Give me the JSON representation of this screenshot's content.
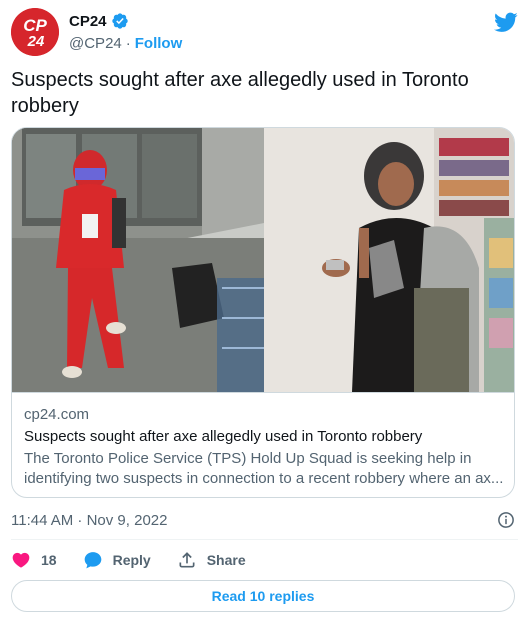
{
  "account": {
    "avatar_text_top": "CP",
    "avatar_text_bottom": "24",
    "display_name": "CP24",
    "handle": "@CP24",
    "separator": "·",
    "follow_label": "Follow",
    "verified": true
  },
  "tweet": {
    "text": "Suspects sought after axe allegedly used in Toronto robbery"
  },
  "card": {
    "domain": "cp24.com",
    "title": "Suspects sought after axe allegedly used in Toronto robbery",
    "description_line1": "The Toronto Police Service (TPS) Hold Up Squad is seeking help in",
    "description_line2": "identifying two suspects in connection to a recent robbery where an ax..."
  },
  "meta": {
    "timestamp": "11:44 AM · Nov 9, 2022"
  },
  "actions": {
    "like_count": "18",
    "reply_label": "Reply",
    "share_label": "Share"
  },
  "replies": {
    "label": "Read 10 replies"
  },
  "colors": {
    "brand_blue": "#1d9bf0",
    "like_pink": "#f91880",
    "avatar_red": "#d6262c"
  }
}
